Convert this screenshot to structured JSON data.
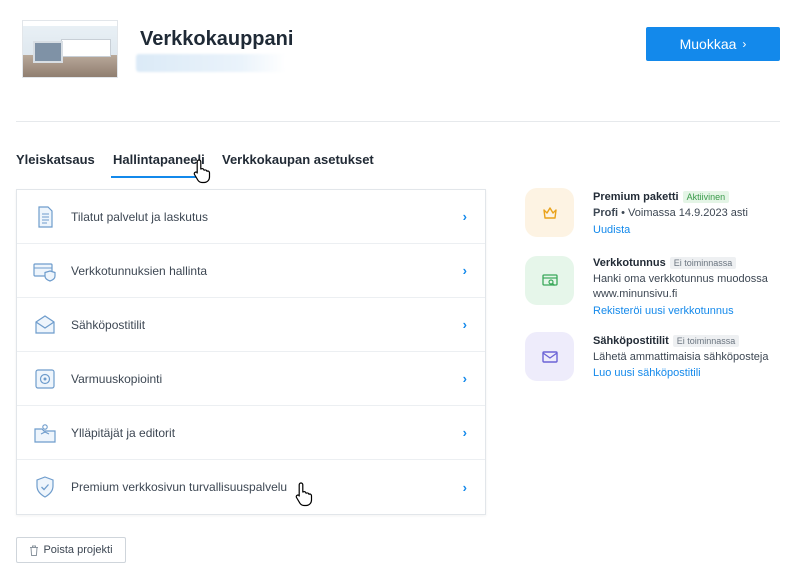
{
  "header": {
    "site_title": "Verkkokauppani",
    "edit_label": "Muokkaa",
    "edit_chevron": "›"
  },
  "tabs": [
    {
      "label": "Yleiskatsaus",
      "active": false
    },
    {
      "label": "Hallintapaneeli",
      "active": true
    },
    {
      "label": "Verkkokaupan asetukset",
      "active": false
    }
  ],
  "menu": {
    "items": [
      {
        "label": "Tilatut palvelut ja laskutus",
        "icon": "document-icon"
      },
      {
        "label": "Verkkotunnuksien hallinta",
        "icon": "domain-shield-icon"
      },
      {
        "label": "Sähköpostitilit",
        "icon": "mail-icon"
      },
      {
        "label": "Varmuuskopiointi",
        "icon": "safe-icon"
      },
      {
        "label": "Ylläpitäjät ja editorit",
        "icon": "users-folder-icon"
      },
      {
        "label": "Premium verkkosivun turvallisuuspalvelu",
        "icon": "shield-check-icon"
      }
    ],
    "chevron": "›"
  },
  "side": {
    "premium": {
      "title": "Premium paketti",
      "badge": "Aktiivinen",
      "desc_bold": "Profi",
      "desc_rest": " • Voimassa 14.9.2023 asti",
      "link": "Uudista",
      "icon": "crown-icon",
      "bg": "#fdf3e3",
      "fg": "#e9a21b"
    },
    "domain": {
      "title": "Verkkotunnus",
      "badge": "Ei toiminnassa",
      "desc": "Hanki oma verkkotunnus muodossa www.minunsivu.fi",
      "link": "Rekisteröi uusi verkkotunnus",
      "icon": "domain-search-icon",
      "bg": "#e6f6ea",
      "fg": "#3aa85a"
    },
    "email": {
      "title": "Sähköpostitilit",
      "badge": "Ei toiminnassa",
      "desc": "Lähetä ammattimaisia sähköposteja",
      "link": "Luo uusi sähköpostitili",
      "icon": "envelope-icon",
      "bg": "#eeecfb",
      "fg": "#6b63d6"
    }
  },
  "footer": {
    "delete_label": "Poista projekti"
  },
  "colors": {
    "accent": "#1389eb"
  }
}
